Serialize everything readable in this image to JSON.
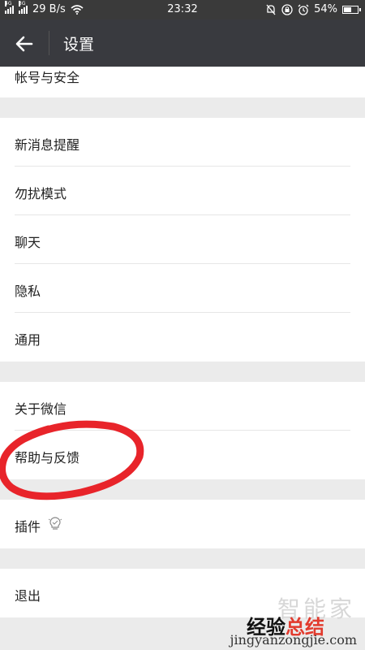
{
  "statusbar": {
    "signal1_tag": "4G",
    "signal2_tag": "3G",
    "speed": "29 B/s",
    "time": "23:32",
    "battery_pct": "54%",
    "battery_level": 0.54
  },
  "header": {
    "title": "设置"
  },
  "settings": {
    "account": "帐号与安全",
    "notifications": "新消息提醒",
    "dnd": "勿扰模式",
    "chat": "聊天",
    "privacy": "隐私",
    "general": "通用",
    "about": "关于微信",
    "help": "帮助与反馈",
    "plugins": "插件",
    "logout": "退出"
  },
  "watermark": {
    "line1": "智能家",
    "line2_a": "经验",
    "line2_b": "总结",
    "line3": "jingyanzongjie.com"
  },
  "colors": {
    "appbar": "#393a3f",
    "background": "#ebebeb",
    "annotation": "#e8242a"
  }
}
